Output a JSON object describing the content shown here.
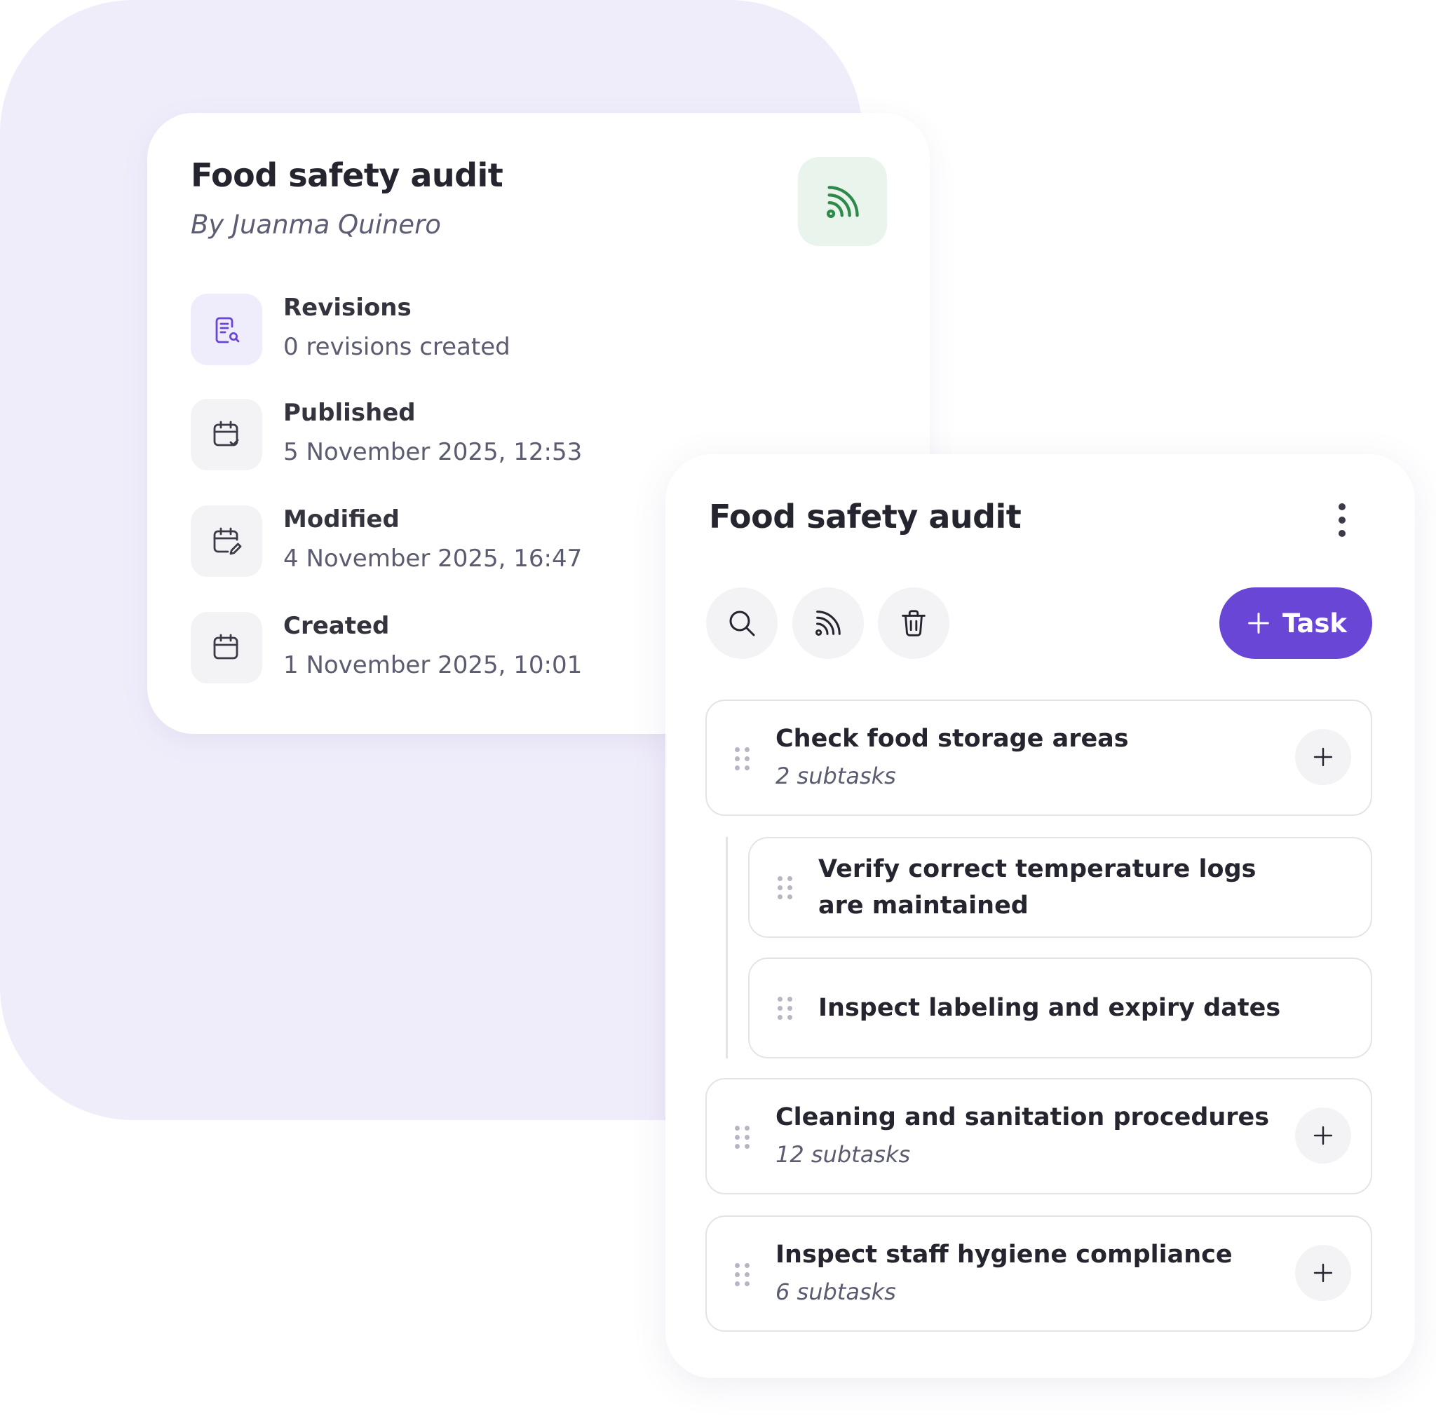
{
  "colors": {
    "background_blob": "#f0edfb",
    "accent": "#6a46d6",
    "rss_green": "#2f8a4a",
    "rss_badge_bg": "#e9f4ec",
    "text_primary": "#25252f",
    "text_secondary": "#5b5c70"
  },
  "details": {
    "title": "Food safety audit",
    "author": "By Juanma Quinero",
    "badge_icon": "rss-icon",
    "items": [
      {
        "label": "Revisions",
        "value": "0 revisions created",
        "icon": "document-search-icon"
      },
      {
        "label": "Published",
        "value": "5 November 2025, 12:53",
        "icon": "calendar-check-icon"
      },
      {
        "label": "Modified",
        "value": "4 November 2025, 16:47",
        "icon": "calendar-edit-icon"
      },
      {
        "label": "Created",
        "value": "1 November 2025, 10:01",
        "icon": "calendar-icon"
      }
    ]
  },
  "panel": {
    "title": "Food safety audit",
    "more_icon": "more-vertical-icon",
    "toolbar": {
      "search_icon": "search-icon",
      "rss_icon": "rss-icon",
      "delete_icon": "trash-icon",
      "add_task_label": "Task",
      "add_task_icon": "plus-icon"
    },
    "tasks": [
      {
        "name": "Check food storage areas",
        "subtasks": "2 subtasks"
      },
      {
        "name": "Verify correct temperature logs are maintained"
      },
      {
        "name": "Inspect labeling and expiry dates"
      },
      {
        "name": "Cleaning and sanitation procedures",
        "subtasks": "12 subtasks"
      },
      {
        "name": "Inspect staff hygiene compliance",
        "subtasks": "6 subtasks"
      }
    ]
  }
}
